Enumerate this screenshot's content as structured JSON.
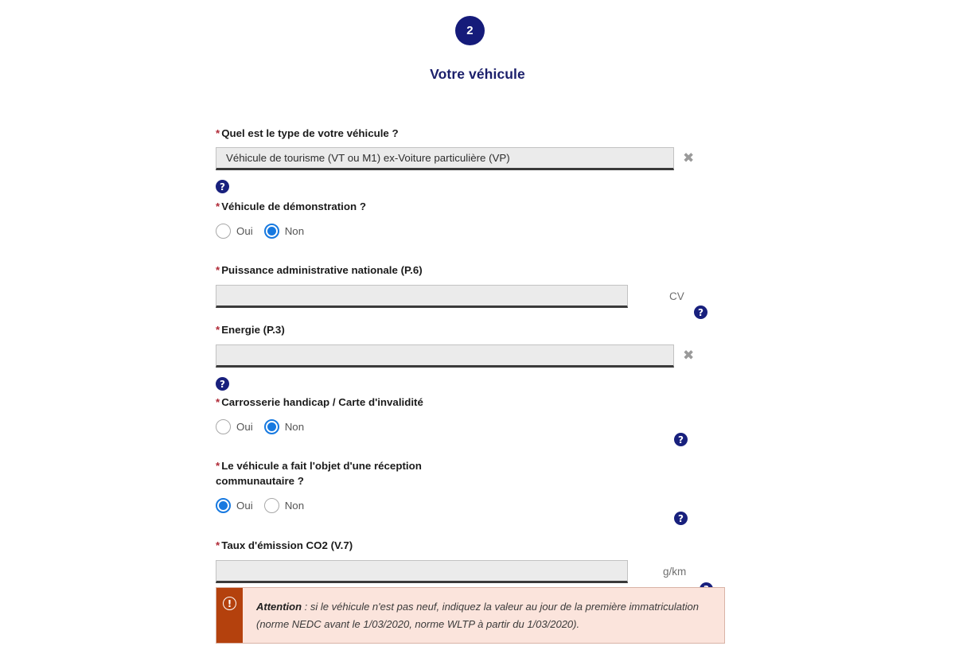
{
  "step": {
    "number": "2"
  },
  "section": {
    "title": "Votre véhicule"
  },
  "colors": {
    "brand_navy": "#151b7a",
    "title_blue": "#1b1f6b",
    "required_red": "#b02a37",
    "radio_blue": "#1779e0",
    "warning_bar": "#b4410d",
    "warning_bg": "#fbe4dc"
  },
  "fields": {
    "vehicle_type": {
      "label": "Quel est le type de votre véhicule ?",
      "required_marker": "*",
      "value": "Véhicule de tourisme (VT ou M1) ex-Voiture particulière (VP)",
      "clear_icon": "✖",
      "help_icon": "?"
    },
    "demo_vehicle": {
      "label": "Véhicule de démonstration ?",
      "required_marker": "*",
      "options": [
        {
          "label": "Oui",
          "selected": false
        },
        {
          "label": "Non",
          "selected": true
        }
      ]
    },
    "power": {
      "label": "Puissance administrative nationale (P.6)",
      "required_marker": "*",
      "value": "",
      "unit": "CV",
      "help_icon": "?"
    },
    "energy": {
      "label": "Energie (P.3)",
      "required_marker": "*",
      "value": "",
      "clear_icon": "✖",
      "help_icon": "?"
    },
    "handicap_body": {
      "label": "Carrosserie handicap / Carte d'invalidité",
      "required_marker": "*",
      "options": [
        {
          "label": "Oui",
          "selected": false
        },
        {
          "label": "Non",
          "selected": true
        }
      ],
      "help_icon": "?"
    },
    "eu_reception": {
      "label": "Le véhicule a fait l'objet d'une réception\ncommunautaire ?",
      "required_marker": "*",
      "options": [
        {
          "label": "Oui",
          "selected": true
        },
        {
          "label": "Non",
          "selected": false
        }
      ],
      "help_icon": "?"
    },
    "co2": {
      "label": "Taux d'émission CO2 (V.7)",
      "required_marker": "*",
      "value": "",
      "unit": "g/km",
      "help_icon": "?"
    }
  },
  "warning": {
    "icon": "!",
    "strong": "Attention",
    "text": " : si le véhicule n'est pas neuf, indiquez la valeur au jour de la première immatriculation (norme NEDC avant le 1/03/2020, norme WLTP à partir du 1/03/2020)."
  }
}
